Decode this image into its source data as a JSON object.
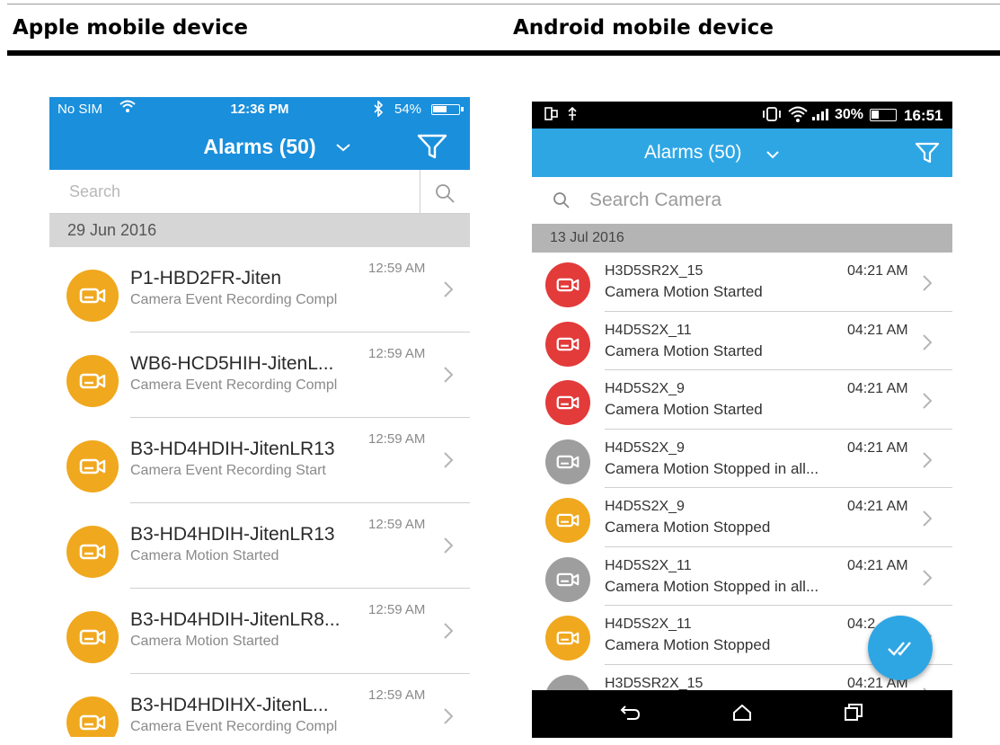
{
  "document": {
    "left_heading": "Apple mobile device",
    "right_heading": "Android mobile device"
  },
  "ios": {
    "status": {
      "carrier": "No SIM",
      "time": "12:36 PM",
      "battery": "54%",
      "battery_level": 0.54
    },
    "nav": {
      "title": "Alarms (50)"
    },
    "search": {
      "placeholder": "Search"
    },
    "date_header": "29 Jun 2016",
    "alarms": [
      {
        "name": "P1-HBD2FR-Jiten",
        "desc": "Camera Event Recording Compl",
        "time": "12:59 AM",
        "icon": "camera-icon",
        "color": "#f0a81e"
      },
      {
        "name": "WB6-HCD5HIH-JitenL...",
        "desc": "Camera Event Recording Compl",
        "time": "12:59 AM",
        "icon": "camera-icon",
        "color": "#f0a81e"
      },
      {
        "name": "B3-HD4HDIH-JitenLR13",
        "desc": "Camera Event Recording Start",
        "time": "12:59 AM",
        "icon": "camera-icon",
        "color": "#f0a81e"
      },
      {
        "name": "B3-HD4HDIH-JitenLR13",
        "desc": "Camera Motion Started",
        "time": "12:59 AM",
        "icon": "camera-icon",
        "color": "#f0a81e"
      },
      {
        "name": "B3-HD4HDIH-JitenLR8...",
        "desc": "Camera Motion Started",
        "time": "12:59 AM",
        "icon": "camera-icon",
        "color": "#f0a81e"
      },
      {
        "name": "B3-HD4HDIHX-JitenL...",
        "desc": "Camera Event Recording Compl",
        "time": "12:59 AM",
        "icon": "camera-icon",
        "color": "#f0a81e"
      }
    ]
  },
  "android": {
    "status": {
      "battery": "30%",
      "time": "16:51",
      "battery_level": 0.3
    },
    "toolbar": {
      "title": "Alarms (50)"
    },
    "search": {
      "placeholder": "Search Camera"
    },
    "date_header": "13 Jul 2016",
    "alarms": [
      {
        "name": "H3D5SR2X_15",
        "desc": "Camera Motion Started",
        "time": "04:21 AM",
        "color": "red"
      },
      {
        "name": "H4D5S2X_11",
        "desc": "Camera Motion Started",
        "time": "04:21 AM",
        "color": "red"
      },
      {
        "name": "H4D5S2X_9",
        "desc": "Camera Motion Started",
        "time": "04:21 AM",
        "color": "red"
      },
      {
        "name": "H4D5S2X_9",
        "desc": "Camera Motion Stopped in all...",
        "time": "04:21 AM",
        "color": "gray"
      },
      {
        "name": "H4D5S2X_9",
        "desc": "Camera Motion Stopped",
        "time": "04:21 AM",
        "color": "orange"
      },
      {
        "name": "H4D5S2X_11",
        "desc": "Camera Motion Stopped in all...",
        "time": "04:21 AM",
        "color": "gray"
      },
      {
        "name": "H4D5S2X_11",
        "desc": "Camera Motion Stopped",
        "time": "04:2",
        "color": "orange"
      },
      {
        "name": "H3D5SR2X_15",
        "desc": "",
        "time": "04:21 AM",
        "color": "gray"
      }
    ],
    "colors": {
      "red": "#e33a3a",
      "gray": "#9e9e9e",
      "orange": "#f0a81e",
      "accent": "#2ea6e4"
    },
    "fab_icon": "double-check-icon"
  }
}
